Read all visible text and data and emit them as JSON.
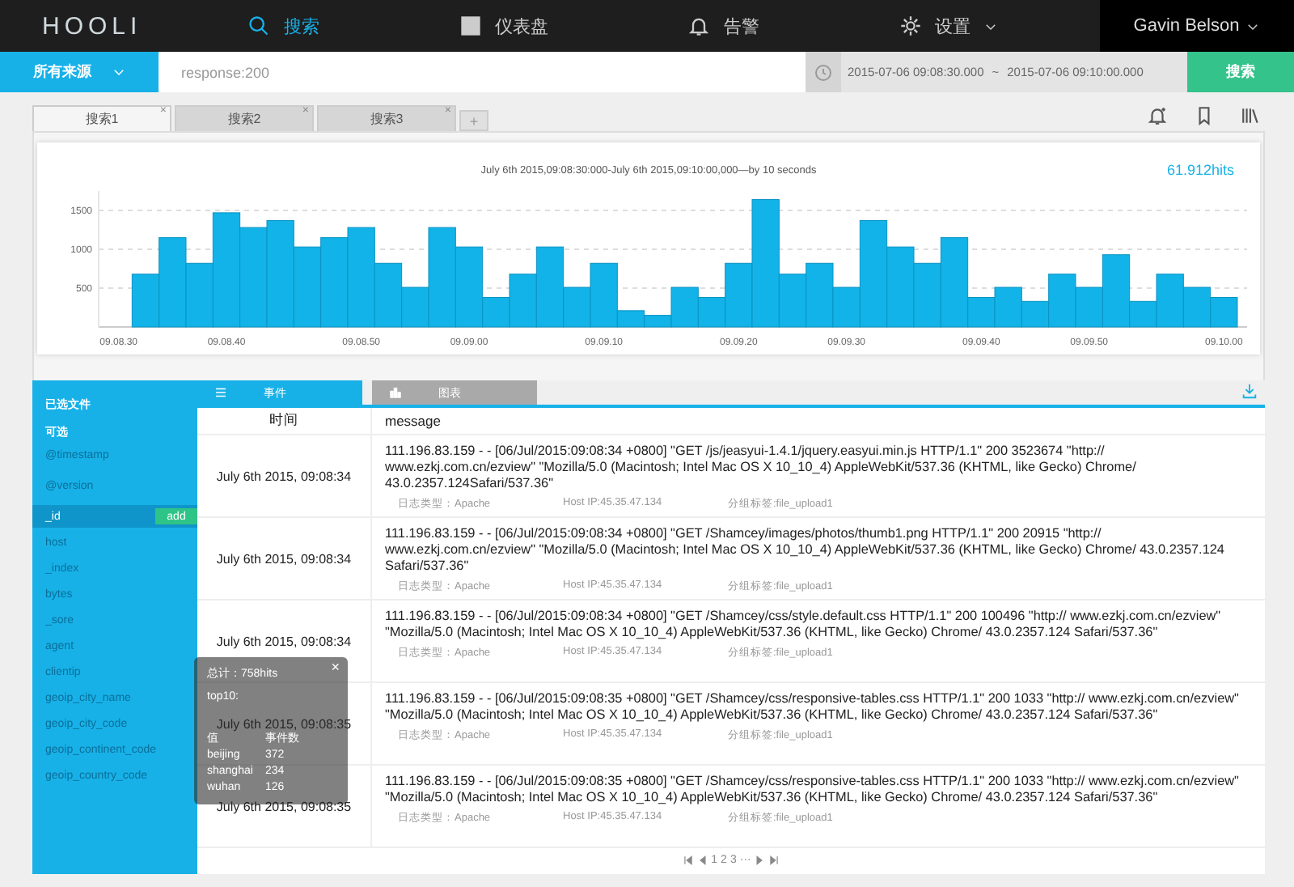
{
  "nav": {
    "logo": "HOOLI",
    "items": [
      {
        "label": "搜索",
        "kind": "search",
        "selected": true,
        "dropdown": false
      },
      {
        "label": "仪表盘",
        "kind": "dashboard",
        "selected": false,
        "dropdown": false
      },
      {
        "label": "告警",
        "kind": "bell",
        "selected": false,
        "dropdown": false
      },
      {
        "label": "设置",
        "kind": "gear",
        "selected": false,
        "dropdown": true
      }
    ],
    "user": "Gavin Belson"
  },
  "filter": {
    "source": "所有来源",
    "query": "response:200",
    "time_from": "2015-07-06 09:08:30.000",
    "separator": "~",
    "time_to": "2015-07-06 09:10:00.000",
    "search_button": "搜索"
  },
  "search_tabs": [
    {
      "label": "搜索1",
      "selected": true,
      "close": "×"
    },
    {
      "label": "搜索2",
      "selected": false,
      "close": "×"
    },
    {
      "label": "搜索3",
      "selected": false,
      "close": "×"
    }
  ],
  "add_tab": "+",
  "histogram": {
    "title": "July 6th 2015,09:08:30:000-July 6th 2015,09:10:00,000—by 10 seconds",
    "hits": "61.912hits",
    "chart_data": {
      "type": "bar",
      "categories": [
        "09.08.30",
        null,
        null,
        null,
        "09.08.40",
        null,
        null,
        null,
        null,
        "09.08.50",
        null,
        null,
        null,
        "09.09.00",
        null,
        null,
        null,
        null,
        "09.09.10",
        null,
        null,
        null,
        null,
        "09.09.20",
        null,
        null,
        null,
        "09.09.30",
        null,
        null,
        null,
        null,
        "09.09.40",
        null,
        null,
        null,
        "09.09.50",
        null,
        null,
        null,
        null,
        "09.10.00"
      ],
      "series": [
        {
          "color": "#12b3e8",
          "values": [
            null,
            680,
            1150,
            820,
            1470,
            1280,
            1370,
            1030,
            1150,
            1280,
            820,
            510,
            1280,
            1030,
            380,
            680,
            1030,
            510,
            820,
            210,
            150,
            510,
            380,
            820,
            1640,
            680,
            820,
            510,
            1370,
            1030,
            820,
            1150,
            380,
            510,
            330,
            680,
            510,
            930,
            330,
            680,
            510,
            380
          ]
        }
      ],
      "ylim": [
        0,
        1750
      ],
      "yticks": [
        500,
        1000,
        1500
      ],
      "grid": true
    }
  },
  "sidebar": {
    "selected_heading": "已选文件",
    "available_heading": "可选",
    "add_button": "add",
    "fields": [
      {
        "name": "@timestamp",
        "selected": false
      },
      {
        "name": "@version",
        "selected": false
      },
      {
        "name": "_id",
        "selected": true
      },
      {
        "name": "host",
        "selected": false
      },
      {
        "name": "_index",
        "selected": false
      },
      {
        "name": "bytes",
        "selected": false
      },
      {
        "name": "_sore",
        "selected": false
      },
      {
        "name": "agent",
        "selected": false
      },
      {
        "name": "clientip",
        "selected": false
      },
      {
        "name": "geoip_city_name",
        "selected": false
      },
      {
        "name": "geoip_city_code",
        "selected": false
      },
      {
        "name": "geoip_continent_code",
        "selected": false
      },
      {
        "name": "geoip_country_code",
        "selected": false
      }
    ]
  },
  "view_tabs": [
    {
      "label": "事件",
      "kind": "list",
      "selected": true
    },
    {
      "label": "图表",
      "kind": "chart",
      "selected": false
    }
  ],
  "table": {
    "columns": [
      "时间",
      "message"
    ],
    "rows": [
      {
        "time": "July 6th 2015, 09:08:34",
        "message": "111.196.83.159 - - [06/Jul/2015:09:08:34 +0800] \"GET /js/jeasyui-1.4.1/jquery.easyui.min.js HTTP/1.1\" 200 3523674 \"http:// www.ezkj.com.cn/ezview\" \"Mozilla/5.0 (Macintosh; Intel Mac OS X 10_10_4) AppleWebKit/537.36 (KHTML, like Gecko) Chrome/ 43.0.2357.124Safari/537.36\"",
        "meta": [
          "日志类型：Apache",
          "Host IP:45.35.47.134",
          "分组标签:file_upload1"
        ]
      },
      {
        "time": "July 6th 2015, 09:08:34",
        "message": "111.196.83.159 - - [06/Jul/2015:09:08:34 +0800] \"GET /Shamcey/images/photos/thumb1.png HTTP/1.1\" 200 20915 \"http:// www.ezkj.com.cn/ezview\" \"Mozilla/5.0 (Macintosh; Intel Mac OS X 10_10_4) AppleWebKit/537.36 (KHTML, like Gecko) Chrome/ 43.0.2357.124 Safari/537.36\"",
        "meta": [
          "日志类型：Apache",
          "Host IP:45.35.47.134",
          "分组标签:file_upload1"
        ]
      },
      {
        "time": "July 6th 2015, 09:08:34",
        "message": "111.196.83.159 - - [06/Jul/2015:09:08:34 +0800] \"GET /Shamcey/css/style.default.css HTTP/1.1\" 200 100496 \"http:// www.ezkj.com.cn/ezview\" \"Mozilla/5.0 (Macintosh; Intel Mac OS X 10_10_4) AppleWebKit/537.36 (KHTML, like Gecko) Chrome/ 43.0.2357.124 Safari/537.36\"",
        "meta": [
          "日志类型：Apache",
          "Host IP:45.35.47.134",
          "分组标签:file_upload1"
        ]
      },
      {
        "time": "July 6th 2015, 09:08:35",
        "message": "111.196.83.159 - - [06/Jul/2015:09:08:35 +0800] \"GET /Shamcey/css/responsive-tables.css HTTP/1.1\" 200 1033 \"http:// www.ezkj.com.cn/ezview\" \"Mozilla/5.0 (Macintosh; Intel Mac OS X 10_10_4) AppleWebKit/537.36 (KHTML, like Gecko) Chrome/ 43.0.2357.124 Safari/537.36\"",
        "meta": [
          "日志类型：Apache",
          "Host IP:45.35.47.134",
          "分组标签:file_upload1"
        ]
      },
      {
        "time": "July 6th 2015, 09:08:35",
        "message": "111.196.83.159 - - [06/Jul/2015:09:08:35 +0800] \"GET /Shamcey/css/responsive-tables.css HTTP/1.1\" 200 1033 \"http:// www.ezkj.com.cn/ezview\" \"Mozilla/5.0 (Macintosh; Intel Mac OS X 10_10_4) AppleWebKit/537.36 (KHTML, like Gecko) Chrome/ 43.0.2357.124 Safari/537.36\"",
        "meta": [
          "日志类型：Apache",
          "Host IP:45.35.47.134",
          "分组标签:file_upload1"
        ]
      }
    ]
  },
  "pagination": {
    "pages": [
      "1",
      "2",
      "3"
    ],
    "more": "···"
  },
  "field_popover": {
    "total": "总计：758hits",
    "top_label": "top10:",
    "close": "×",
    "columns": [
      "值",
      "事件数"
    ],
    "rows": [
      {
        "value": "beijing",
        "count": "372"
      },
      {
        "value": "shanghai",
        "count": "234"
      },
      {
        "value": "wuhan",
        "count": "126"
      }
    ]
  }
}
